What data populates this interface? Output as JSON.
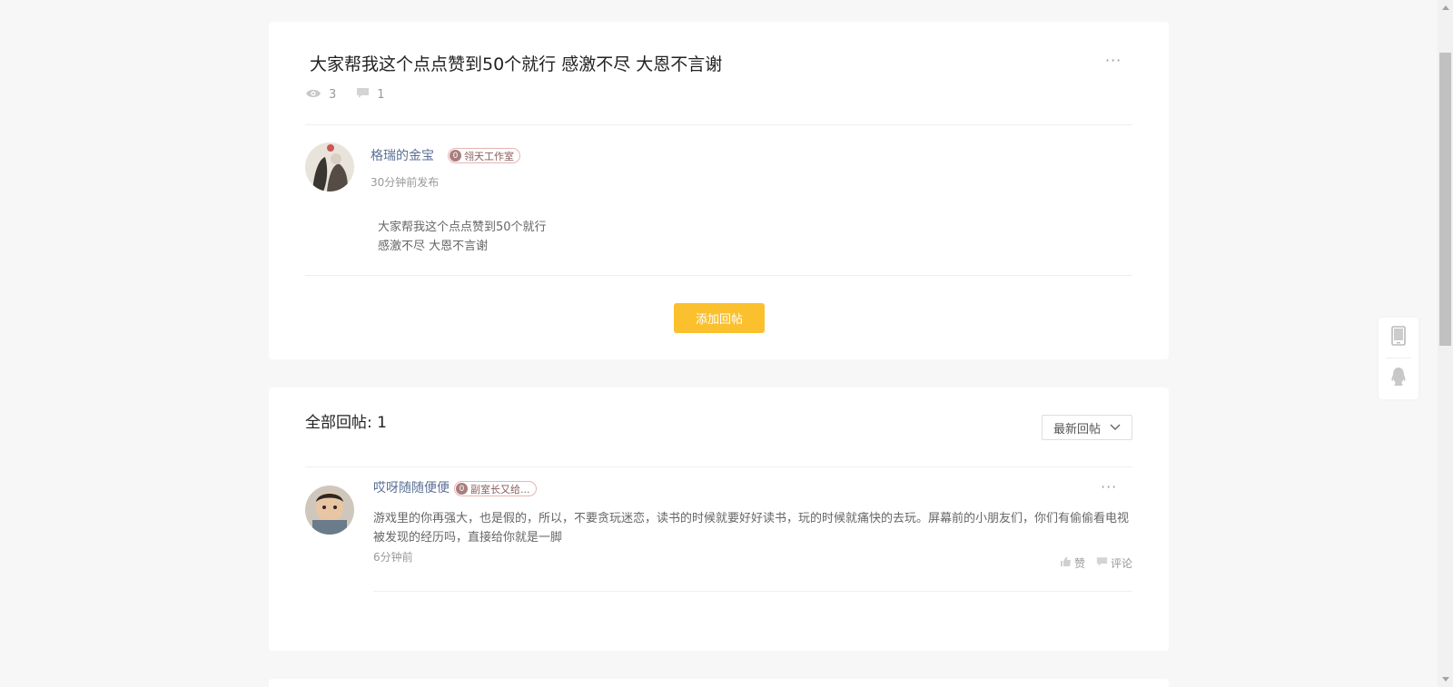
{
  "post": {
    "title": "大家帮我这个点点赞到50个就行 感激不尽 大恩不言谢",
    "views": "3",
    "comments": "1",
    "author": {
      "name": "格瑞的金宝",
      "badge_level": "0",
      "badge_text": "翎天工作室"
    },
    "time": "30分钟前发布",
    "body_lines": [
      "大家帮我这个点点赞到50个就行",
      "感激不尽 大恩不言谢"
    ],
    "reply_button": "添加回帖"
  },
  "replies": {
    "section_label": "全部回帖: 1",
    "sort_label": "最新回帖",
    "items": [
      {
        "author": "哎呀随随便便",
        "badge_level": "0",
        "badge_text": "副室长又给...",
        "text": "游戏里的你再强大，也是假的，所以，不要贪玩迷恋，读书的时候就要好好读书，玩的时候就痛快的去玩。屏幕前的小朋友们，你们有偷偷看电视被发现的经历吗，直接给你就是一脚",
        "time": "6分钟前",
        "like_label": "赞",
        "comment_label": "评论"
      }
    ]
  },
  "more_label": "···",
  "colors": {
    "accent": "#fbc02d",
    "link": "#5b6f95"
  },
  "icons": [
    "eye-icon",
    "comment-icon",
    "phone-icon",
    "qq-icon",
    "thumb-up-icon",
    "chevron-down-icon"
  ]
}
